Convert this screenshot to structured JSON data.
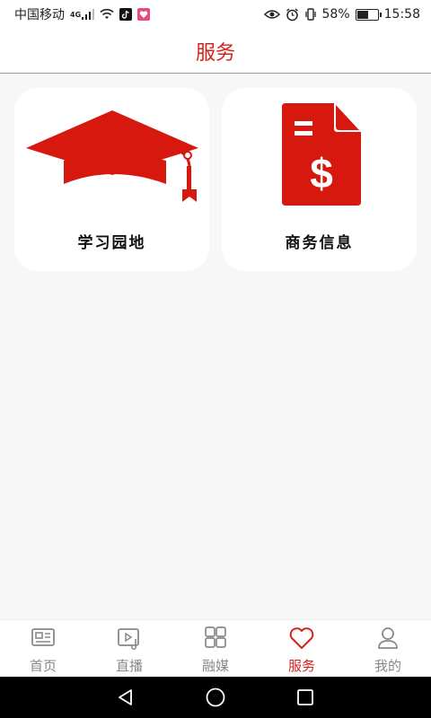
{
  "status_bar": {
    "carrier": "中国移动",
    "network": "4G",
    "battery": "58%",
    "battery_level": 0.58,
    "time": "15:58"
  },
  "header": {
    "title": "服务"
  },
  "cards": [
    {
      "label": "学习园地",
      "icon": "graduation-cap-icon"
    },
    {
      "label": "商务信息",
      "icon": "dollar-document-icon"
    }
  ],
  "tabs": [
    {
      "label": "首页",
      "icon": "news-icon",
      "active": false
    },
    {
      "label": "直播",
      "icon": "video-music-icon",
      "active": false
    },
    {
      "label": "融媒",
      "icon": "grid-icon",
      "active": false
    },
    {
      "label": "服务",
      "icon": "heart-icon",
      "active": true
    },
    {
      "label": "我的",
      "icon": "user-icon",
      "active": false
    }
  ],
  "colors": {
    "accent": "#d6221b",
    "inactive": "#888888"
  }
}
